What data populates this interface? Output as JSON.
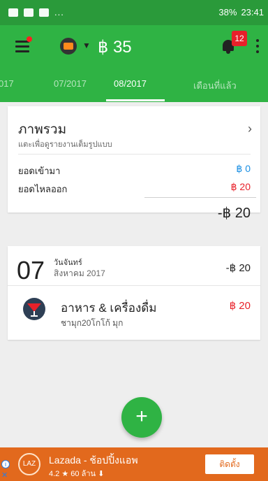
{
  "status_bar": {
    "icons_left": [
      "gallery-icon",
      "play-store-icon",
      "chat-icon"
    ],
    "more": "...",
    "battery": "38%",
    "time": "23:41"
  },
  "app_bar": {
    "balance": "฿ 35",
    "notification_count": "12"
  },
  "tabs": [
    "017",
    "07/2017",
    "08/2017",
    "เดือนที่แล้ว"
  ],
  "overview": {
    "title": "ภาพรวม",
    "subtitle": "แตะเพื่อดูรายงานเต็มรูปแบบ",
    "inflow_label": "ยอดเข้ามา",
    "inflow_value": "฿ 0",
    "outflow_label": "ยอดไหลออก",
    "outflow_value": "฿ 20",
    "total": "-฿ 20"
  },
  "day": {
    "number": "07",
    "weekday": "วันจันทร์",
    "month_year": "สิงหาคม 2017",
    "total": "-฿ 20",
    "transaction": {
      "category": "อาหาร & เครื่องดื่ม",
      "note": "ชามุก20โกโก้ มุก",
      "amount": "฿ 20"
    }
  },
  "ad": {
    "logo_text": "LAZ",
    "title": "Lazada - ช้อปปิ้งแอพ",
    "rating": "4.2",
    "downloads": "60 ล้าน",
    "install_label": "ติดตั้ง"
  },
  "colors": {
    "primary": "#2fb344",
    "inflow": "#1a8fe3",
    "outflow": "#e8212a",
    "ad": "#e2691d"
  }
}
